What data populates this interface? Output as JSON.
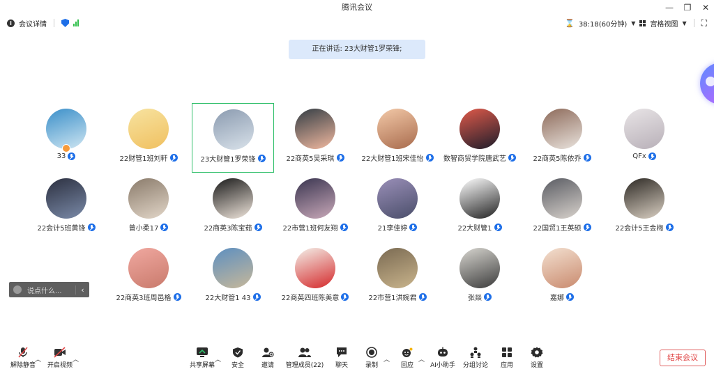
{
  "window": {
    "title": "腾讯会议"
  },
  "infobar": {
    "details_label": "会议详情",
    "timer": "38:18(60分钟)",
    "view_label": "宫格视图"
  },
  "speaking_banner": "正在讲话: 23大财管1罗荣锋;",
  "participants": [
    {
      "name": "33",
      "colors": [
        "#3b8fc9",
        "#cfe6f2"
      ]
    },
    {
      "name": "22财管1班刘轩",
      "colors": [
        "#f7e3a0",
        "#f0c060"
      ]
    },
    {
      "name": "23大财管1罗荣锋",
      "colors": [
        "#8b9bb0",
        "#d9e2ea"
      ]
    },
    {
      "name": "22商英5吴采琪",
      "colors": [
        "#333d44",
        "#f2b9a0"
      ]
    },
    {
      "name": "22大财管1班宋佳怡",
      "colors": [
        "#f3c9a8",
        "#a86b4d"
      ]
    },
    {
      "name": "数智商贸学院唐武艺",
      "colors": [
        "#e05a4a",
        "#1d1d2b"
      ]
    },
    {
      "name": "22商英5陈依乔",
      "colors": [
        "#8d6a5a",
        "#e9e3dd"
      ]
    },
    {
      "name": "QFx",
      "colors": [
        "#e8e4e6",
        "#b8b0b8"
      ]
    },
    {
      "name": "22会计5班黄锋",
      "colors": [
        "#2c3040",
        "#7a8aa8"
      ]
    },
    {
      "name": "曾小柔17",
      "colors": [
        "#8a7b6b",
        "#e2d6c8"
      ]
    },
    {
      "name": "22商英3陈宝茹",
      "colors": [
        "#1a1a1a",
        "#f0e6dc"
      ]
    },
    {
      "name": "22市营1班何友翔",
      "colors": [
        "#3a3550",
        "#c9a9b9"
      ]
    },
    {
      "name": "21李佳婷",
      "colors": [
        "#9a8fb8",
        "#4a4e6a"
      ]
    },
    {
      "name": "22大财管1",
      "colors": [
        "#ffffff",
        "#222222"
      ]
    },
    {
      "name": "22国贸1王英硕",
      "colors": [
        "#5a5c63",
        "#d8d2cc"
      ]
    },
    {
      "name": "22会计5王金梅",
      "colors": [
        "#2e2a25",
        "#d9cfc2"
      ]
    },
    {
      "name": "22商英3班周邑格",
      "colors": [
        "#f0a8a0",
        "#c97a6c"
      ]
    },
    {
      "name": "22大财管1   43",
      "colors": [
        "#5d8fc0",
        "#c7b89a"
      ]
    },
    {
      "name": "22商英四班陈美意",
      "colors": [
        "#f4f1ea",
        "#d4282a"
      ]
    },
    {
      "name": "22市营1洪婉君",
      "colors": [
        "#7a6a52",
        "#c9b48c"
      ]
    },
    {
      "name": "张燚",
      "colors": [
        "#d8d6d0",
        "#3b3b3b"
      ]
    },
    {
      "name": "嘉娜",
      "colors": [
        "#f3e0d0",
        "#c98a6e"
      ]
    }
  ],
  "chat": {
    "placeholder": "说点什么..."
  },
  "toolbar": {
    "mute": "解除静音",
    "video": "开启视频",
    "share": "共享屏幕",
    "security": "安全",
    "invite": "邀请",
    "members": "管理成员(22)",
    "chat": "聊天",
    "record": "录制",
    "reply": "回应",
    "ai": "AI小助手",
    "breakout": "分组讨论",
    "apps": "应用",
    "settings": "设置",
    "end": "结束会议"
  },
  "colors": {
    "accent": "#1e6fe8",
    "active_border": "#2fbf6a",
    "end": "#e04545"
  }
}
